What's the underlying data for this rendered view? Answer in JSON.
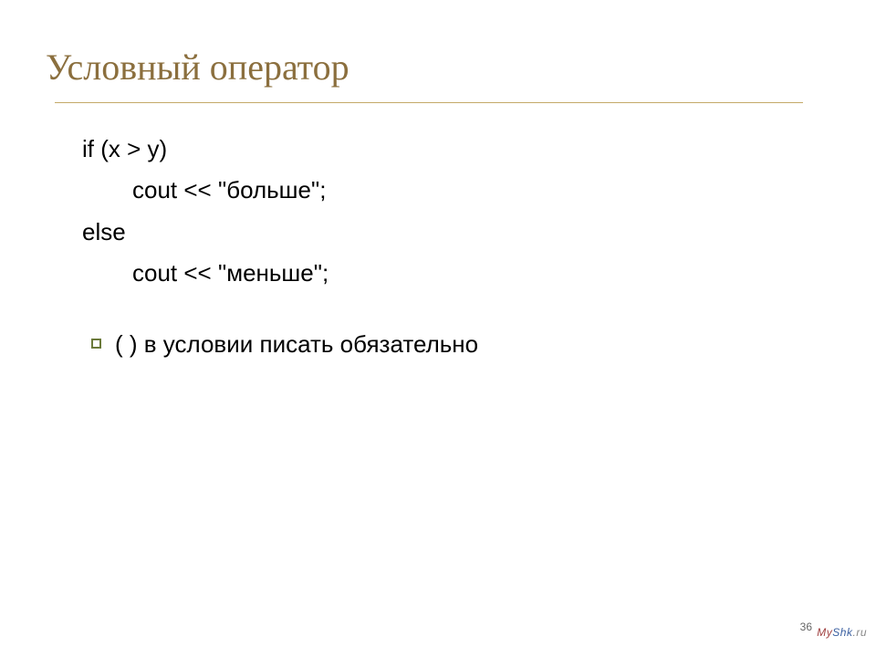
{
  "title": "Условный оператор",
  "code": {
    "line1": "if (x > y)",
    "line2": "cout << \"больше\";",
    "line3": "else",
    "line4": "cout << \"меньше\";"
  },
  "bullet": "(  )  в условии писать обязательно",
  "page_number": "36",
  "watermark": {
    "my": "My",
    "shk": "Shk",
    "ru": ".ru"
  }
}
